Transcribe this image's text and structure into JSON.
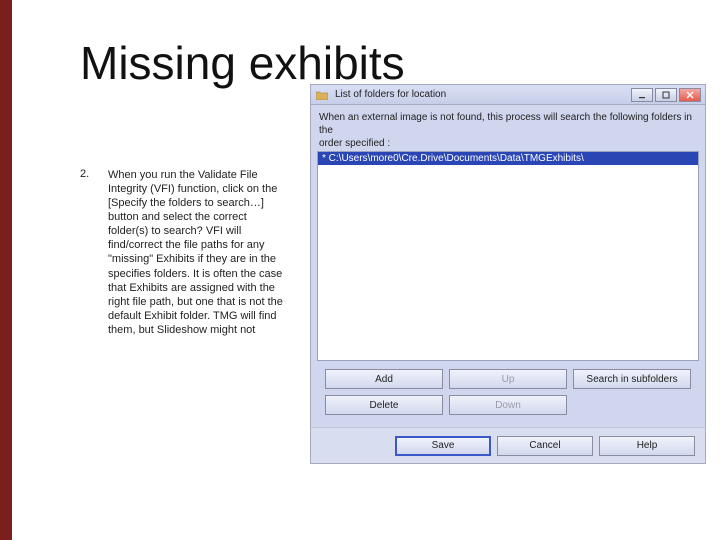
{
  "slide": {
    "title": "Missing exhibits",
    "list_number": "2.",
    "list_body": "When you run the Validate File Integrity (VFI) function, click on the [Specify the folders to search…] button and select the correct folder(s) to search? VFI will find/correct the file paths for any \"missing\" Exhibits if they are in the specifies folders.  It is often the case that Exhibits are assigned with the right file path, but one that is not the default Exhibit folder.  TMG will find them, but Slideshow might not"
  },
  "dialog": {
    "title": "List of folders for location",
    "explain_line1": "When an external image is not found, this process will search the following folders in the",
    "explain_line2": "order specified :",
    "selected_path": "* C:\\Users\\more0\\Cre.Drive\\Documents\\Data\\TMGExhibits\\",
    "buttons": {
      "add": "Add",
      "delete": "Delete",
      "up": "Up",
      "down": "Down",
      "subsearch": "Search in subfolders"
    },
    "footer": {
      "save": "Save",
      "cancel": "Cancel",
      "help": "Help"
    }
  }
}
